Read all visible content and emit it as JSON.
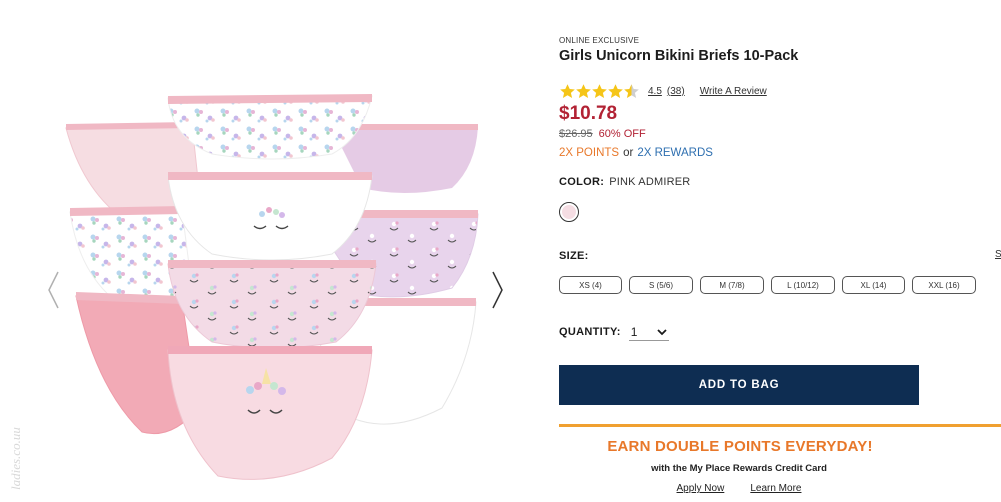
{
  "product": {
    "badge": "ONLINE EXCLUSIVE",
    "title": "Girls Unicorn Bikini Briefs 10-Pack",
    "rating": {
      "value": "4.5",
      "count": "(38)",
      "write_review": "Write A Review",
      "stars_filled_fraction": 0.9
    },
    "price": "$10.78",
    "original_price": "$26.95",
    "discount": "60% OFF",
    "points": "2X POINTS",
    "or": "or",
    "rewards": "2X REWARDS",
    "color": {
      "label": "COLOR:",
      "value": "PINK ADMIRER",
      "swatch_color": "#f5dde3"
    },
    "size": {
      "label": "SIZE:",
      "chart_link": "S",
      "options": [
        "XS (4)",
        "S (5/6)",
        "M (7/8)",
        "L (10/12)",
        "XL (14)",
        "XXL (16)"
      ]
    },
    "quantity": {
      "label": "QUANTITY:",
      "value": "1"
    },
    "add_to_bag": "ADD TO BAG"
  },
  "promo": {
    "title": "EARN DOUBLE POINTS EVERYDAY!",
    "subtitle": "with the My Place Rewards Credit Card",
    "apply_now": "Apply Now",
    "learn_more": "Learn More"
  },
  "gallery": {
    "prev_icon": "chevron-left-icon",
    "next_icon": "chevron-right-icon"
  },
  "colors": {
    "price_red": "#b22234",
    "points_orange": "#e8782a",
    "rewards_blue": "#2e6fb0",
    "button_navy": "#0e2d52",
    "promo_line": "#f0a030",
    "star_gold": "#f5c518"
  }
}
